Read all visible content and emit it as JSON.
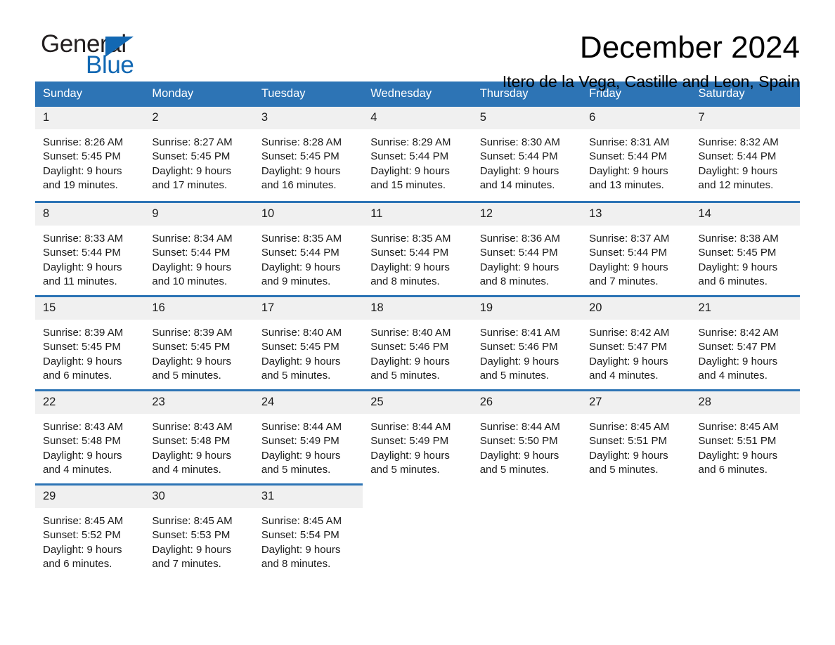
{
  "brand": {
    "name_part1": "General",
    "name_part2": "Blue",
    "accent_color": "#1268b3"
  },
  "header": {
    "month_title": "December 2024",
    "location": "Itero de la Vega, Castille and Leon, Spain"
  },
  "calendar": {
    "header_bg": "#2d74b5",
    "daynum_bg": "#f0f0f0",
    "weekday_headers": [
      "Sunday",
      "Monday",
      "Tuesday",
      "Wednesday",
      "Thursday",
      "Friday",
      "Saturday"
    ],
    "weeks": [
      [
        {
          "day": "1",
          "sunrise": "Sunrise: 8:26 AM",
          "sunset": "Sunset: 5:45 PM",
          "daylight_line1": "Daylight: 9 hours",
          "daylight_line2": "and 19 minutes."
        },
        {
          "day": "2",
          "sunrise": "Sunrise: 8:27 AM",
          "sunset": "Sunset: 5:45 PM",
          "daylight_line1": "Daylight: 9 hours",
          "daylight_line2": "and 17 minutes."
        },
        {
          "day": "3",
          "sunrise": "Sunrise: 8:28 AM",
          "sunset": "Sunset: 5:45 PM",
          "daylight_line1": "Daylight: 9 hours",
          "daylight_line2": "and 16 minutes."
        },
        {
          "day": "4",
          "sunrise": "Sunrise: 8:29 AM",
          "sunset": "Sunset: 5:44 PM",
          "daylight_line1": "Daylight: 9 hours",
          "daylight_line2": "and 15 minutes."
        },
        {
          "day": "5",
          "sunrise": "Sunrise: 8:30 AM",
          "sunset": "Sunset: 5:44 PM",
          "daylight_line1": "Daylight: 9 hours",
          "daylight_line2": "and 14 minutes."
        },
        {
          "day": "6",
          "sunrise": "Sunrise: 8:31 AM",
          "sunset": "Sunset: 5:44 PM",
          "daylight_line1": "Daylight: 9 hours",
          "daylight_line2": "and 13 minutes."
        },
        {
          "day": "7",
          "sunrise": "Sunrise: 8:32 AM",
          "sunset": "Sunset: 5:44 PM",
          "daylight_line1": "Daylight: 9 hours",
          "daylight_line2": "and 12 minutes."
        }
      ],
      [
        {
          "day": "8",
          "sunrise": "Sunrise: 8:33 AM",
          "sunset": "Sunset: 5:44 PM",
          "daylight_line1": "Daylight: 9 hours",
          "daylight_line2": "and 11 minutes."
        },
        {
          "day": "9",
          "sunrise": "Sunrise: 8:34 AM",
          "sunset": "Sunset: 5:44 PM",
          "daylight_line1": "Daylight: 9 hours",
          "daylight_line2": "and 10 minutes."
        },
        {
          "day": "10",
          "sunrise": "Sunrise: 8:35 AM",
          "sunset": "Sunset: 5:44 PM",
          "daylight_line1": "Daylight: 9 hours",
          "daylight_line2": "and 9 minutes."
        },
        {
          "day": "11",
          "sunrise": "Sunrise: 8:35 AM",
          "sunset": "Sunset: 5:44 PM",
          "daylight_line1": "Daylight: 9 hours",
          "daylight_line2": "and 8 minutes."
        },
        {
          "day": "12",
          "sunrise": "Sunrise: 8:36 AM",
          "sunset": "Sunset: 5:44 PM",
          "daylight_line1": "Daylight: 9 hours",
          "daylight_line2": "and 8 minutes."
        },
        {
          "day": "13",
          "sunrise": "Sunrise: 8:37 AM",
          "sunset": "Sunset: 5:44 PM",
          "daylight_line1": "Daylight: 9 hours",
          "daylight_line2": "and 7 minutes."
        },
        {
          "day": "14",
          "sunrise": "Sunrise: 8:38 AM",
          "sunset": "Sunset: 5:45 PM",
          "daylight_line1": "Daylight: 9 hours",
          "daylight_line2": "and 6 minutes."
        }
      ],
      [
        {
          "day": "15",
          "sunrise": "Sunrise: 8:39 AM",
          "sunset": "Sunset: 5:45 PM",
          "daylight_line1": "Daylight: 9 hours",
          "daylight_line2": "and 6 minutes."
        },
        {
          "day": "16",
          "sunrise": "Sunrise: 8:39 AM",
          "sunset": "Sunset: 5:45 PM",
          "daylight_line1": "Daylight: 9 hours",
          "daylight_line2": "and 5 minutes."
        },
        {
          "day": "17",
          "sunrise": "Sunrise: 8:40 AM",
          "sunset": "Sunset: 5:45 PM",
          "daylight_line1": "Daylight: 9 hours",
          "daylight_line2": "and 5 minutes."
        },
        {
          "day": "18",
          "sunrise": "Sunrise: 8:40 AM",
          "sunset": "Sunset: 5:46 PM",
          "daylight_line1": "Daylight: 9 hours",
          "daylight_line2": "and 5 minutes."
        },
        {
          "day": "19",
          "sunrise": "Sunrise: 8:41 AM",
          "sunset": "Sunset: 5:46 PM",
          "daylight_line1": "Daylight: 9 hours",
          "daylight_line2": "and 5 minutes."
        },
        {
          "day": "20",
          "sunrise": "Sunrise: 8:42 AM",
          "sunset": "Sunset: 5:47 PM",
          "daylight_line1": "Daylight: 9 hours",
          "daylight_line2": "and 4 minutes."
        },
        {
          "day": "21",
          "sunrise": "Sunrise: 8:42 AM",
          "sunset": "Sunset: 5:47 PM",
          "daylight_line1": "Daylight: 9 hours",
          "daylight_line2": "and 4 minutes."
        }
      ],
      [
        {
          "day": "22",
          "sunrise": "Sunrise: 8:43 AM",
          "sunset": "Sunset: 5:48 PM",
          "daylight_line1": "Daylight: 9 hours",
          "daylight_line2": "and 4 minutes."
        },
        {
          "day": "23",
          "sunrise": "Sunrise: 8:43 AM",
          "sunset": "Sunset: 5:48 PM",
          "daylight_line1": "Daylight: 9 hours",
          "daylight_line2": "and 4 minutes."
        },
        {
          "day": "24",
          "sunrise": "Sunrise: 8:44 AM",
          "sunset": "Sunset: 5:49 PM",
          "daylight_line1": "Daylight: 9 hours",
          "daylight_line2": "and 5 minutes."
        },
        {
          "day": "25",
          "sunrise": "Sunrise: 8:44 AM",
          "sunset": "Sunset: 5:49 PM",
          "daylight_line1": "Daylight: 9 hours",
          "daylight_line2": "and 5 minutes."
        },
        {
          "day": "26",
          "sunrise": "Sunrise: 8:44 AM",
          "sunset": "Sunset: 5:50 PM",
          "daylight_line1": "Daylight: 9 hours",
          "daylight_line2": "and 5 minutes."
        },
        {
          "day": "27",
          "sunrise": "Sunrise: 8:45 AM",
          "sunset": "Sunset: 5:51 PM",
          "daylight_line1": "Daylight: 9 hours",
          "daylight_line2": "and 5 minutes."
        },
        {
          "day": "28",
          "sunrise": "Sunrise: 8:45 AM",
          "sunset": "Sunset: 5:51 PM",
          "daylight_line1": "Daylight: 9 hours",
          "daylight_line2": "and 6 minutes."
        }
      ],
      [
        {
          "day": "29",
          "sunrise": "Sunrise: 8:45 AM",
          "sunset": "Sunset: 5:52 PM",
          "daylight_line1": "Daylight: 9 hours",
          "daylight_line2": "and 6 minutes."
        },
        {
          "day": "30",
          "sunrise": "Sunrise: 8:45 AM",
          "sunset": "Sunset: 5:53 PM",
          "daylight_line1": "Daylight: 9 hours",
          "daylight_line2": "and 7 minutes."
        },
        {
          "day": "31",
          "sunrise": "Sunrise: 8:45 AM",
          "sunset": "Sunset: 5:54 PM",
          "daylight_line1": "Daylight: 9 hours",
          "daylight_line2": "and 8 minutes."
        },
        null,
        null,
        null,
        null
      ]
    ]
  }
}
